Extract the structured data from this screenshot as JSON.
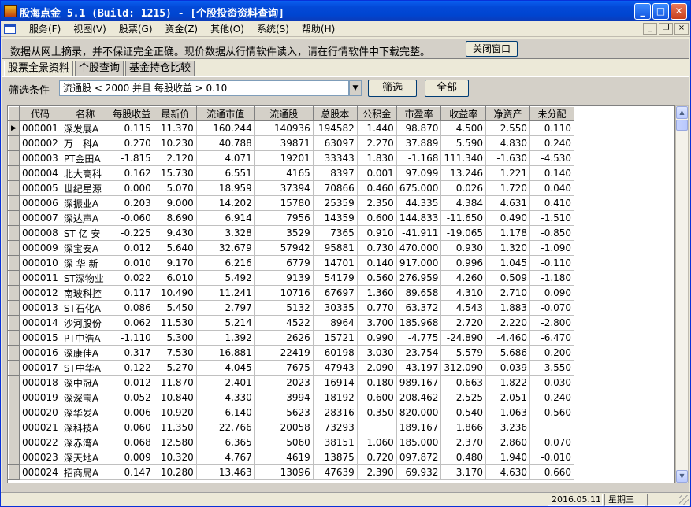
{
  "window": {
    "title": "股海点金 5.1 (Build: 1215) - [个股投资资料查询]"
  },
  "menu": [
    "服务(F)",
    "视图(V)",
    "股票(G)",
    "资金(Z)",
    "其他(O)",
    "系统(S)",
    "帮助(H)"
  ],
  "notice": {
    "text": "数据从网上摘录，并不保证完全正确。现价数据从行情软件读入，请在行情软件中下载完整。",
    "close_label": "关闭窗口"
  },
  "tabs": [
    "股票全景资料",
    "个股查询",
    "基金持仓比较"
  ],
  "filter": {
    "label": "筛选条件",
    "value": "流通股 < 2000  并且 每股收益 > 0.10",
    "filter_button": "筛选",
    "all_button": "全部"
  },
  "table": {
    "columns": [
      "代码",
      "名称",
      "每股收益",
      "最新价",
      "流通市值",
      "流通股",
      "总股本",
      "公积金",
      "市盈率",
      "收益率",
      "净资产",
      "未分配"
    ],
    "rows": [
      [
        "000001",
        "深发展A",
        "0.115",
        "11.370",
        "160.244",
        "140936",
        "194582",
        "1.440",
        "98.870",
        "4.500",
        "2.550",
        "0.110"
      ],
      [
        "000002",
        "万　科A",
        "0.270",
        "10.230",
        "40.788",
        "39871",
        "63097",
        "2.270",
        "37.889",
        "5.590",
        "4.830",
        "0.240"
      ],
      [
        "000003",
        "PT金田A",
        "-1.815",
        "2.120",
        "4.071",
        "19201",
        "33343",
        "1.830",
        "-1.168",
        "111.340",
        "-1.630",
        "-4.530"
      ],
      [
        "000004",
        "北大高科",
        "0.162",
        "15.730",
        "6.551",
        "4165",
        "8397",
        "0.001",
        "97.099",
        "13.246",
        "1.221",
        "0.140"
      ],
      [
        "000005",
        "世纪星源",
        "0.000",
        "5.070",
        "18.959",
        "37394",
        "70866",
        "0.460",
        "675.000",
        "0.026",
        "1.720",
        "0.040"
      ],
      [
        "000006",
        "深振业A",
        "0.203",
        "9.000",
        "14.202",
        "15780",
        "25359",
        "2.350",
        "44.335",
        "4.384",
        "4.631",
        "0.410"
      ],
      [
        "000007",
        "深达声A",
        "-0.060",
        "8.690",
        "6.914",
        "7956",
        "14359",
        "0.600",
        "144.833",
        "-11.650",
        "0.490",
        "-1.510"
      ],
      [
        "000008",
        "ST 亿 安",
        "-0.225",
        "9.430",
        "3.328",
        "3529",
        "7365",
        "0.910",
        "-41.911",
        "-19.065",
        "1.178",
        "-0.850"
      ],
      [
        "000009",
        "深宝安A",
        "0.012",
        "5.640",
        "32.679",
        "57942",
        "95881",
        "0.730",
        "470.000",
        "0.930",
        "1.320",
        "-1.090"
      ],
      [
        "000010",
        "深 华 新",
        "0.010",
        "9.170",
        "6.216",
        "6779",
        "14701",
        "0.140",
        "917.000",
        "0.996",
        "1.045",
        "-0.110"
      ],
      [
        "000011",
        "ST深物业",
        "0.022",
        "6.010",
        "5.492",
        "9139",
        "54179",
        "0.560",
        "276.959",
        "4.260",
        "0.509",
        "-1.180"
      ],
      [
        "000012",
        "南玻科控",
        "0.117",
        "10.490",
        "11.241",
        "10716",
        "67697",
        "1.360",
        "89.658",
        "4.310",
        "2.710",
        "0.090"
      ],
      [
        "000013",
        "ST石化A",
        "0.086",
        "5.450",
        "2.797",
        "5132",
        "30335",
        "0.770",
        "63.372",
        "4.543",
        "1.883",
        "-0.070"
      ],
      [
        "000014",
        "沙河股份",
        "0.062",
        "11.530",
        "5.214",
        "4522",
        "8964",
        "3.700",
        "185.968",
        "2.720",
        "2.220",
        "-2.800"
      ],
      [
        "000015",
        "PT中浩A",
        "-1.110",
        "5.300",
        "1.392",
        "2626",
        "15721",
        "0.990",
        "-4.775",
        "-24.890",
        "-4.460",
        "-6.470"
      ],
      [
        "000016",
        "深康佳A",
        "-0.317",
        "7.530",
        "16.881",
        "22419",
        "60198",
        "3.030",
        "-23.754",
        "-5.579",
        "5.686",
        "-0.200"
      ],
      [
        "000017",
        "ST中华A",
        "-0.122",
        "5.270",
        "4.045",
        "7675",
        "47943",
        "2.090",
        "-43.197",
        "312.090",
        "0.039",
        "-3.550"
      ],
      [
        "000018",
        "深中冠A",
        "0.012",
        "11.870",
        "2.401",
        "2023",
        "16914",
        "0.180",
        "989.167",
        "0.663",
        "1.822",
        "0.030"
      ],
      [
        "000019",
        "深深宝A",
        "0.052",
        "10.840",
        "4.330",
        "3994",
        "18192",
        "0.600",
        "208.462",
        "2.525",
        "2.051",
        "0.240"
      ],
      [
        "000020",
        "深华发A",
        "0.006",
        "10.920",
        "6.140",
        "5623",
        "28316",
        "0.350",
        "820.000",
        "0.540",
        "1.063",
        "-0.560"
      ],
      [
        "000021",
        "深科技A",
        "0.060",
        "11.350",
        "22.766",
        "20058",
        "73293",
        "",
        "189.167",
        "1.866",
        "3.236",
        ""
      ],
      [
        "000022",
        "深赤湾A",
        "0.068",
        "12.580",
        "6.365",
        "5060",
        "38151",
        "1.060",
        "185.000",
        "2.370",
        "2.860",
        "0.070"
      ],
      [
        "000023",
        "深天地A",
        "0.009",
        "10.320",
        "4.767",
        "4619",
        "13875",
        "0.720",
        "097.872",
        "0.480",
        "1.940",
        "-0.010"
      ],
      [
        "000024",
        "招商局A",
        "0.147",
        "10.280",
        "13.463",
        "13096",
        "47639",
        "2.390",
        "69.932",
        "3.170",
        "4.630",
        "0.660"
      ]
    ]
  },
  "status": {
    "date": "2016.05.11",
    "weekday": "星期三"
  },
  "colors": {
    "titlebar": "#0045d0",
    "face": "#d4d0c8"
  }
}
